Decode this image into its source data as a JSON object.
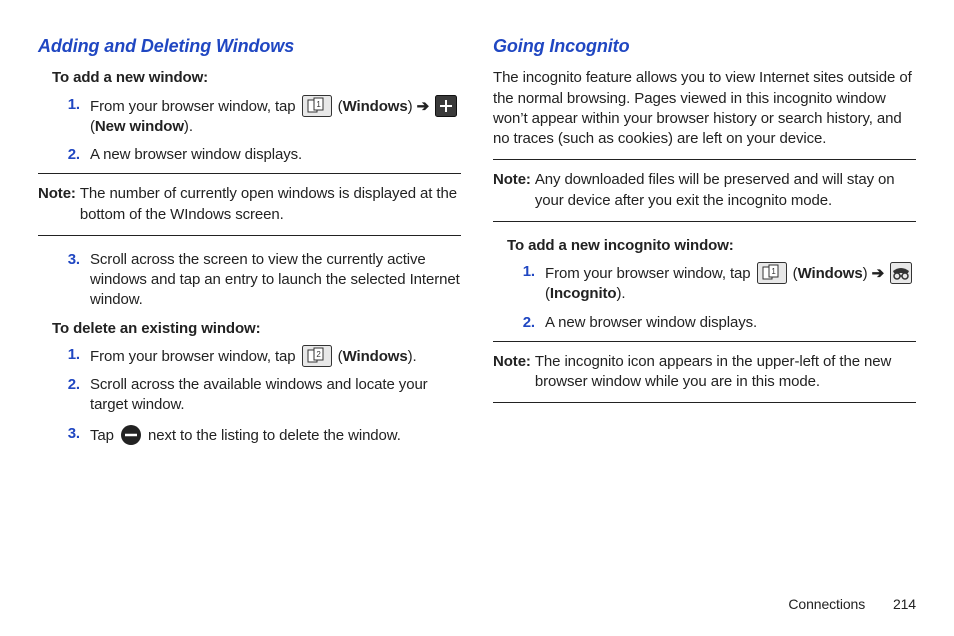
{
  "left": {
    "heading": "Adding and Deleting Windows",
    "sub1": "To add a new window:",
    "step1a_prefix": "From your browser window, tap ",
    "windows_label": "Windows",
    "arrow": "➔",
    "new_window_label": "New window",
    "step1a_suffix": ").",
    "step2a": "A new browser window displays.",
    "note1_label": "Note:",
    "note1_text": "The number of currently open windows is displayed at the bottom of the WIndows screen.",
    "step3a": "Scroll across the screen to view the currently active windows and tap an entry to launch the selected Internet window.",
    "sub2": "To delete an existing window:",
    "step1b_prefix": "From your browser window, tap ",
    "step1b_suffix": ").",
    "step2b": "Scroll across the available windows and locate your target window.",
    "step3b_prefix": "Tap ",
    "step3b_suffix": " next to the listing to delete the window."
  },
  "right": {
    "heading": "Going Incognito",
    "para": "The incognito feature allows you to view Internet sites outside of the normal browsing. Pages viewed in this incognito window won’t appear within your browser history or search history, and no traces (such as cookies) are left on your device.",
    "note1_label": "Note:",
    "note1_text": "Any downloaded files will be preserved and will stay on your device after you exit the incognito mode.",
    "sub1": "To add a new incognito window:",
    "step1_prefix": "From your browser window, tap ",
    "windows_label": "Windows",
    "arrow": "➔",
    "incognito_label": "Incognito",
    "step1_suffix": ").",
    "step2": "A new browser window displays.",
    "note2_label": "Note:",
    "note2_text": "The incognito icon appears in the upper-left of the new browser window while you are in this mode."
  },
  "footer": {
    "section": "Connections",
    "page": "214"
  },
  "nums": {
    "n1": "1.",
    "n2": "2.",
    "n3": "3."
  },
  "punct": {
    "open": " (",
    "close": ")",
    "arrow_space": " "
  }
}
